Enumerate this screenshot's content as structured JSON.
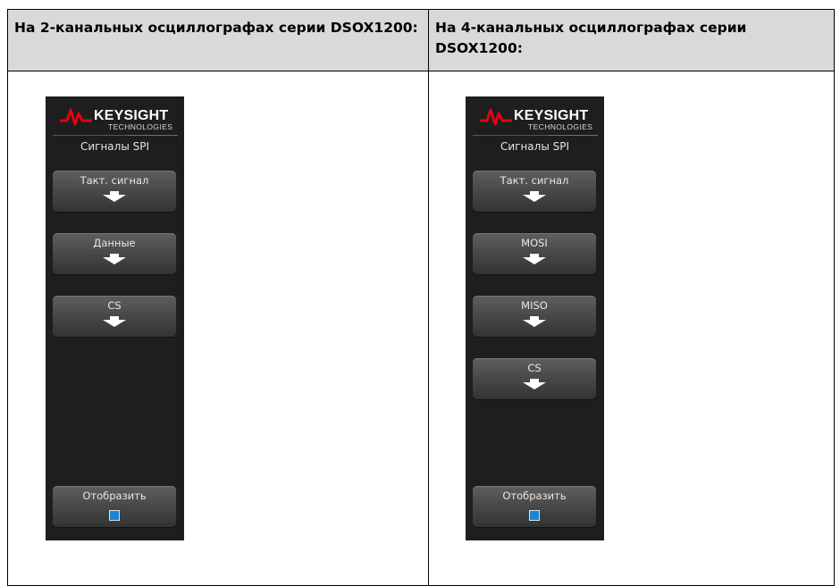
{
  "table": {
    "left_header": "На 2-канальных осциллографах серии DSOX1200:",
    "right_header": "На 4-канальных осциллографах серии DSOX1200:"
  },
  "left_panel": {
    "brand": "KEYSIGHT",
    "brand_sub": "TECHNOLOGIES",
    "title": "Сигналы SPI",
    "softkeys": [
      "Такт. сигнал",
      "Данные",
      "CS"
    ],
    "display_label": "Отобразить"
  },
  "right_panel": {
    "brand": "KEYSIGHT",
    "brand_sub": "TECHNOLOGIES",
    "title": "Сигналы SPI",
    "softkeys": [
      "Такт. сигнал",
      "MOSI",
      "MISO",
      "CS"
    ],
    "display_label": "Отобразить"
  },
  "colors": {
    "header_bg": "#d9d9d9",
    "panel_bg": "#1e1e1e",
    "logo_red": "#e60012",
    "checkbox_blue": "#1a86d0"
  },
  "icons": {
    "logo": "keysight-wave-logo",
    "softkey_arrow": "arrow-down-icon",
    "display_toggle": "checkbox-icon"
  }
}
